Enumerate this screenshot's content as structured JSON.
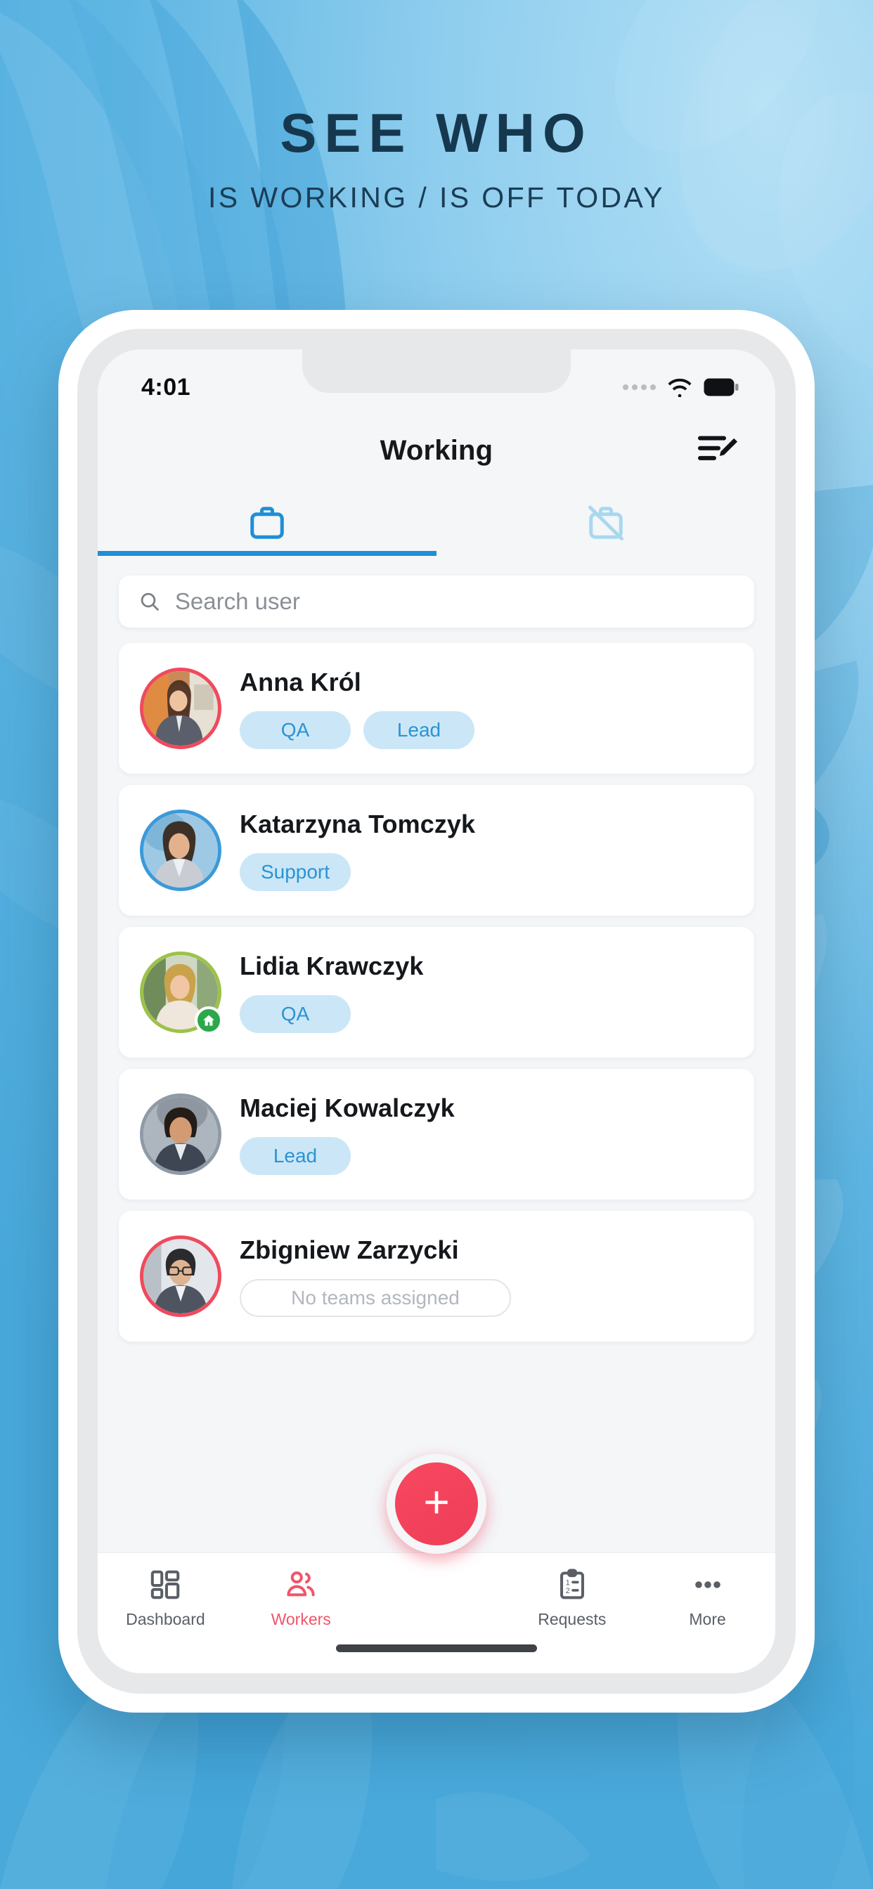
{
  "poster": {
    "headline": "SEE WHO",
    "subheadline": "IS WORKING / IS OFF TODAY",
    "headline_color": "#16384f",
    "background_color": "#63bbe8"
  },
  "statusbar": {
    "time": "4:01",
    "signal_icon": "signal-dots-icon",
    "wifi_icon": "wifi-icon",
    "battery_icon": "battery-full-icon"
  },
  "header": {
    "title": "Working",
    "action_icon": "edit-list-icon"
  },
  "tabs": [
    {
      "name": "working-tab",
      "icon": "briefcase-icon",
      "active": true
    },
    {
      "name": "off-tab",
      "icon": "briefcase-off-icon",
      "active": false
    }
  ],
  "search": {
    "placeholder": "Search user",
    "value": "",
    "icon": "search-icon"
  },
  "users": [
    {
      "name": "Anna Król",
      "ring_color": "#ef4a5e",
      "tags": [
        "QA",
        "Lead"
      ],
      "empty_tag": null,
      "home_badge": false
    },
    {
      "name": "Katarzyna Tomczyk",
      "ring_color": "#3b9ad9",
      "tags": [
        "Support"
      ],
      "empty_tag": null,
      "home_badge": false
    },
    {
      "name": "Lidia Krawczyk",
      "ring_color": "#9cc24a",
      "tags": [
        "QA"
      ],
      "empty_tag": null,
      "home_badge": true,
      "home_badge_icon": "home-icon"
    },
    {
      "name": "Maciej Kowalczyk",
      "ring_color": "#8e9aa6",
      "tags": [
        "Lead"
      ],
      "empty_tag": null,
      "home_badge": false
    },
    {
      "name": "Zbigniew Zarzycki",
      "ring_color": "#ef4a5e",
      "tags": [],
      "empty_tag": "No teams assigned",
      "home_badge": false
    }
  ],
  "fab": {
    "label": "+",
    "icon": "plus-icon",
    "color": "#ee3e58"
  },
  "bottomnav": {
    "active_color": "#f2546b",
    "items": [
      {
        "label": "Dashboard",
        "icon": "dashboard-grid-icon",
        "active": false
      },
      {
        "label": "Workers",
        "icon": "workers-people-icon",
        "active": true
      },
      {
        "label": "Requests",
        "icon": "clipboard-list-icon",
        "active": false
      },
      {
        "label": "More",
        "icon": "more-dots-icon",
        "active": false
      }
    ]
  }
}
